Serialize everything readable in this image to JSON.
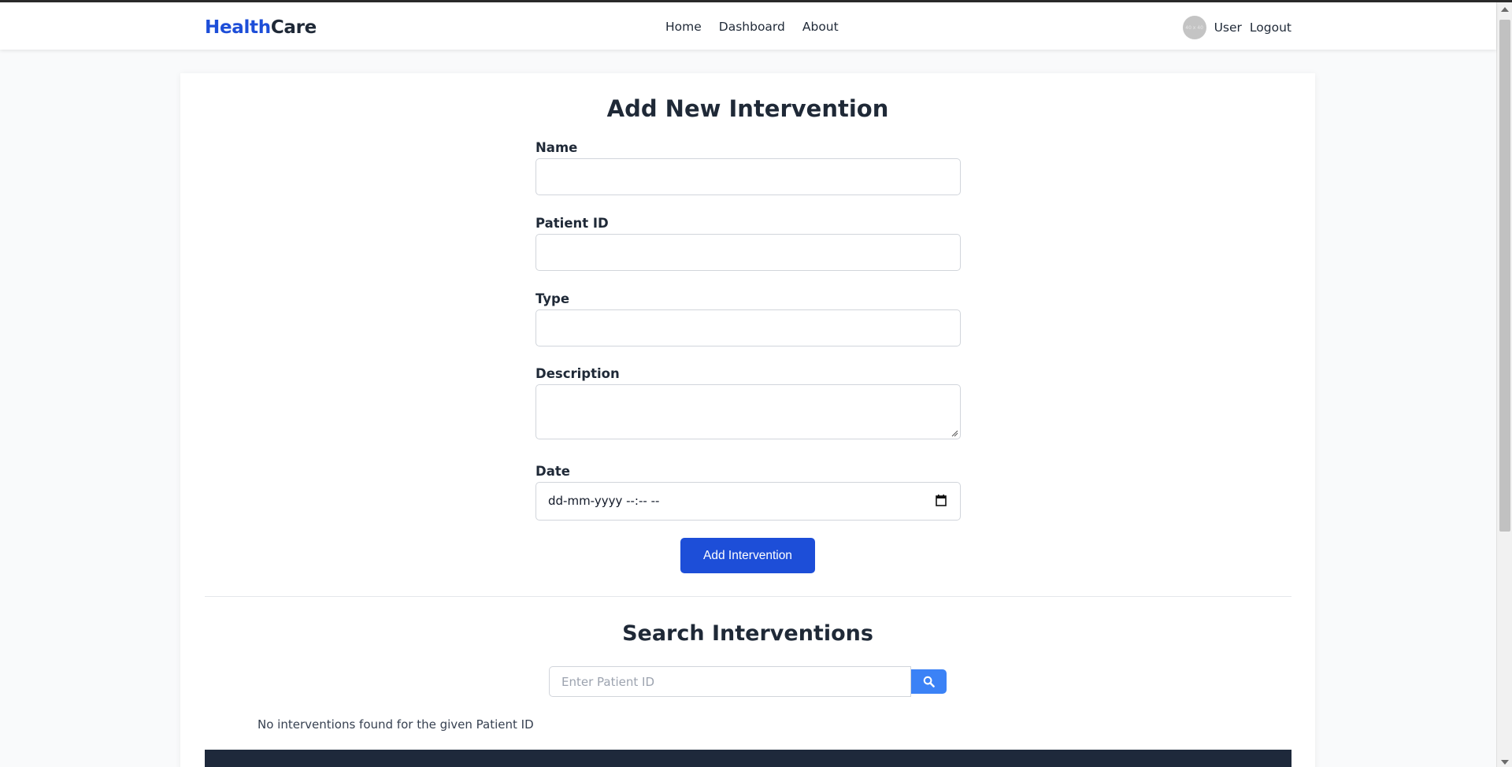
{
  "header": {
    "logo_part1": "Health",
    "logo_part2": "Care",
    "nav": [
      {
        "label": "Home"
      },
      {
        "label": "Dashboard"
      },
      {
        "label": "About"
      }
    ],
    "avatar_text": "40 x 40",
    "user_label": "User",
    "logout_label": "Logout"
  },
  "form": {
    "title": "Add New Intervention",
    "name_label": "Name",
    "patient_id_label": "Patient ID",
    "type_label": "Type",
    "description_label": "Description",
    "date_label": "Date",
    "date_value": "dd-mm-yyyy --:-- --",
    "submit_label": "Add Intervention"
  },
  "search": {
    "title": "Search Interventions",
    "placeholder": "Enter Patient ID",
    "empty_message": "No interventions found for the given Patient ID"
  },
  "colors": {
    "brand": "#1d4ed8",
    "search_button": "#3b82f6",
    "footer": "#1e293b"
  }
}
